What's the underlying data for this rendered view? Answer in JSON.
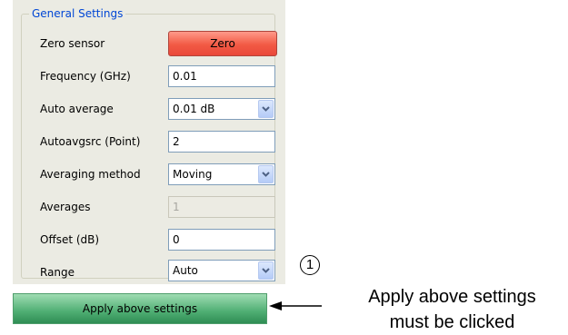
{
  "group": {
    "title": "General Settings"
  },
  "rows": {
    "zero_sensor": {
      "label": "Zero sensor",
      "button": "Zero"
    },
    "frequency": {
      "label": "Frequency (GHz)",
      "value": "0.01"
    },
    "auto_average": {
      "label": "Auto average",
      "value": "0.01 dB"
    },
    "autoavgsrc": {
      "label": "Autoavgsrc (Point)",
      "value": "2"
    },
    "averaging_method": {
      "label": "Averaging method",
      "value": "Moving"
    },
    "averages": {
      "label": "Averages",
      "value": "1"
    },
    "offset": {
      "label": "Offset (dB)",
      "value": "0"
    },
    "range": {
      "label": "Range",
      "value": "Auto"
    }
  },
  "apply_button": {
    "label": "Apply above settings"
  },
  "callout": {
    "number": "1",
    "line1": "Apply above settings",
    "line2": "must be clicked"
  },
  "colors": {
    "zero_button": "#f25a44",
    "apply_button": "#4fae73",
    "group_title": "#0046d5"
  }
}
